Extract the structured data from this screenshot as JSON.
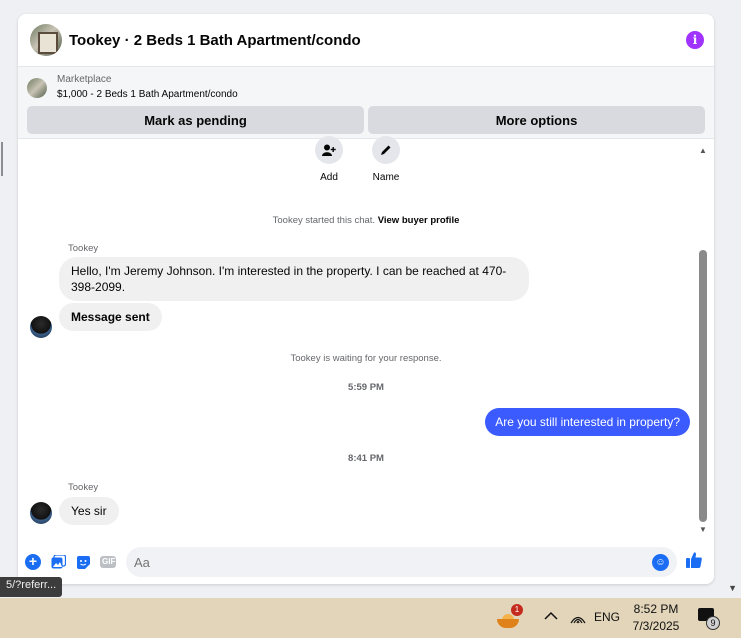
{
  "chat": {
    "title": "Tookey · 2 Beds 1 Bath Apartment/condo",
    "info_icon": "info-icon"
  },
  "listing": {
    "source": "Marketplace",
    "price_title": "$1,000 - 2 Beds 1 Bath Apartment/condo",
    "mark_pending_label": "Mark as pending",
    "more_options_label": "More options"
  },
  "quick_actions": {
    "add_label": "Add",
    "name_label": "Name"
  },
  "messages": {
    "started_text": "Tookey started this chat.",
    "view_profile_link": "View buyer profile",
    "sender_1": "Tookey",
    "msg_1": "Hello, I'm Jeremy Johnson. I'm interested in the property. I can be reached at 470-398-2099.",
    "msg_2": "Message sent",
    "waiting_text": "Tookey is waiting for your response.",
    "time_1": "5:59 PM",
    "out_msg_1": "Are you still interested in property?",
    "time_2": "8:41 PM",
    "sender_2": "Tookey",
    "msg_3": "Yes sir"
  },
  "composer": {
    "placeholder": "Aa",
    "gif_label": "GIF"
  },
  "url_tooltip": "5/?referr...",
  "taskbar": {
    "weather_badge": "1",
    "lang": "ENG",
    "time": "8:52 PM",
    "date": "7/3/2025",
    "notif_count": "9"
  },
  "colors": {
    "accent": "#3b5bff",
    "info": "#a033ff",
    "taskbar": "#e2d5b9"
  }
}
